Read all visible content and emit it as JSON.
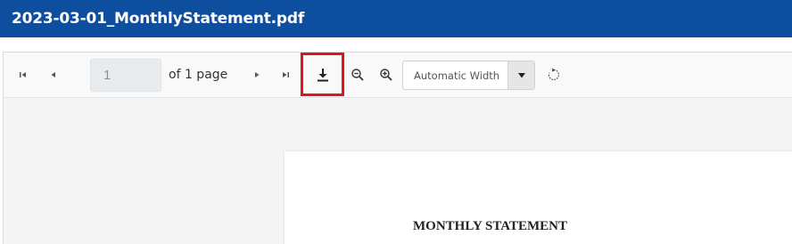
{
  "window": {
    "title": "2023-03-01_MonthlyStatement.pdf"
  },
  "toolbar": {
    "first_page_icon": "first-page-icon",
    "prev_page_icon": "previous-page-icon",
    "page_input_value": "1",
    "page_count_text": "of 1 page",
    "next_page_icon": "next-page-icon",
    "last_page_icon": "last-page-icon",
    "download_icon": "download-icon",
    "zoom_out_icon": "zoom-out-icon",
    "zoom_in_icon": "zoom-in-icon",
    "zoom_select_value": "Automatic Width",
    "rotate_icon": "rotate-icon",
    "highlight_color": "#e3131b"
  },
  "document": {
    "heading": "MONTHLY STATEMENT"
  },
  "colors": {
    "title_bar": "#0d4f9e",
    "toolbar_bg": "#f9f9fa",
    "doc_bg": "#f5f5f5"
  }
}
